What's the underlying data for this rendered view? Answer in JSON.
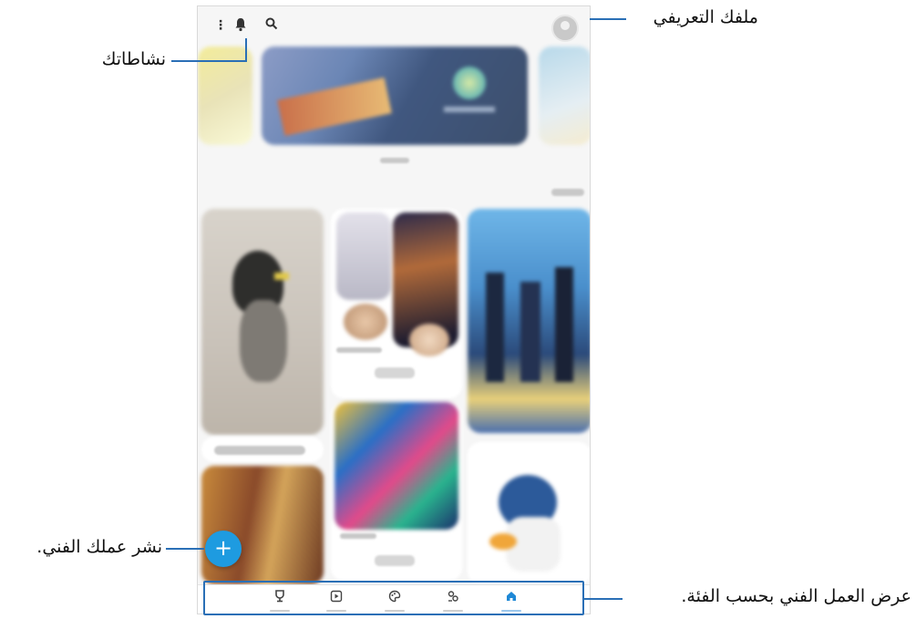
{
  "callouts": {
    "profile": "ملفك التعريفي",
    "activities": "نشاطاتك",
    "publish": "نشر عملك الفني.",
    "categories": "عرض العمل الفني بحسب الفئة."
  },
  "icons": {
    "more": "⋮",
    "bell": "🔔",
    "search": "⌕",
    "fab": "+",
    "nav": [
      "🏆",
      "▶",
      "🎨",
      "⚇",
      "⌂"
    ]
  },
  "colors": {
    "accent": "#2a6fb6",
    "fab": "#1e9be0",
    "nav_active": "#1e88d6"
  }
}
